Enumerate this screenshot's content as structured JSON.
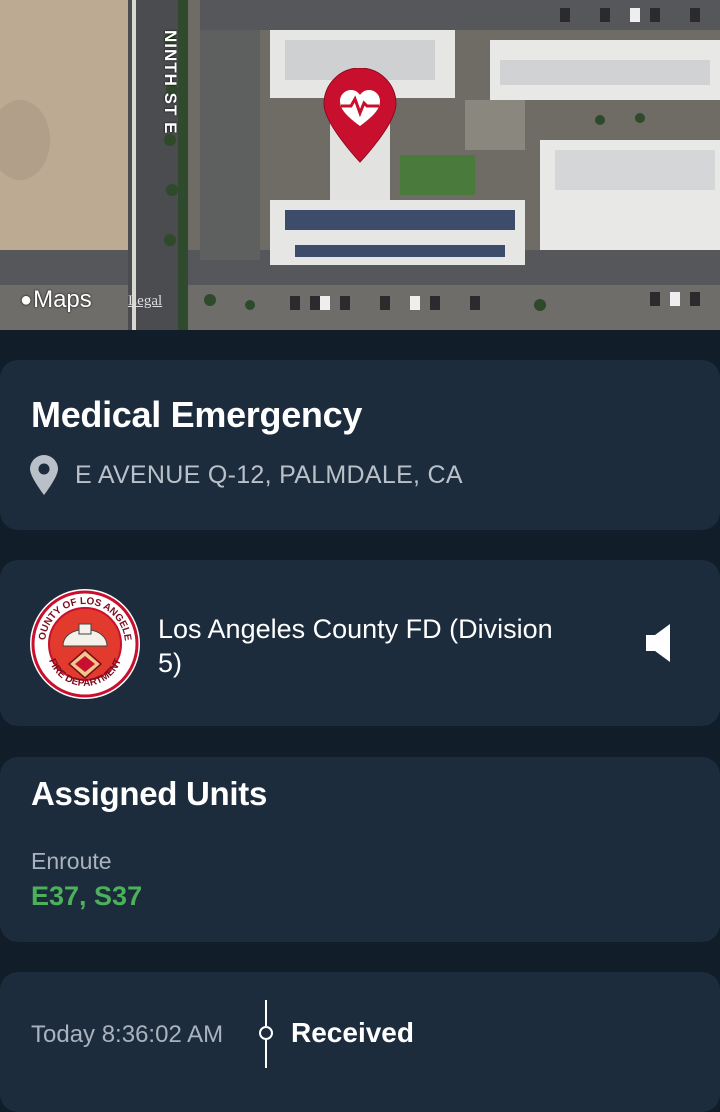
{
  "map": {
    "street_label": "NINTH ST E",
    "maps_brand": "Maps",
    "legal_label": "Legal",
    "marker_icon": "heart-pulse-icon",
    "marker_color": "#c8102e"
  },
  "incident": {
    "title": "Medical Emergency",
    "address": "E AVENUE Q-12, PALMDALE, CA",
    "address_icon": "location-pin-icon"
  },
  "agency": {
    "name": "Los Angeles County FD (Division 5)",
    "logo_text_top": "COUNTY OF LOS ANGELES",
    "logo_text_bottom": "FIRE DEPARTMENT",
    "audio_icon": "speaker-icon"
  },
  "units": {
    "heading": "Assigned Units",
    "status_label": "Enroute",
    "list": "E37, S37",
    "status_color": "#4bb25a"
  },
  "timeline": {
    "time": "Today 8:36:02 AM",
    "event": "Received"
  }
}
